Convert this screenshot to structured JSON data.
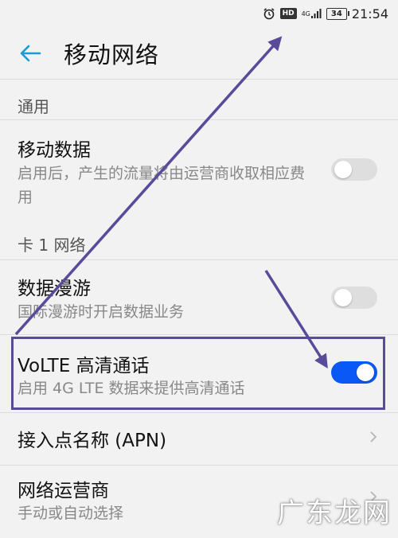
{
  "status_bar": {
    "alarm_icon": "alarm-icon",
    "hd_label": "HD",
    "network_label": "4G",
    "battery_level": "34",
    "time": "21:54"
  },
  "header": {
    "back_icon": "back-arrow-icon",
    "title": "移动网络"
  },
  "sections": {
    "general": {
      "label": "通用"
    },
    "card1": {
      "label": "卡 1 网络"
    }
  },
  "settings": {
    "mobile_data": {
      "title": "移动数据",
      "subtitle": "启用后，产生的流量将由运营商收取相应费用",
      "enabled": false
    },
    "roaming": {
      "title": "数据漫游",
      "subtitle": "国际漫游时开启数据业务",
      "enabled": false
    },
    "volte": {
      "title": "VoLTE 高清通话",
      "subtitle": "启用 4G LTE 数据来提供高清通话",
      "enabled": true
    },
    "apn": {
      "title": "接入点名称 (APN)"
    },
    "operator": {
      "title": "网络运营商",
      "subtitle": "手动或自动选择"
    }
  },
  "watermark": "广东龙网",
  "colors": {
    "accent": "#0a59f7",
    "back_arrow": "#1a9ad6",
    "annotation": "#5a4a9a"
  }
}
